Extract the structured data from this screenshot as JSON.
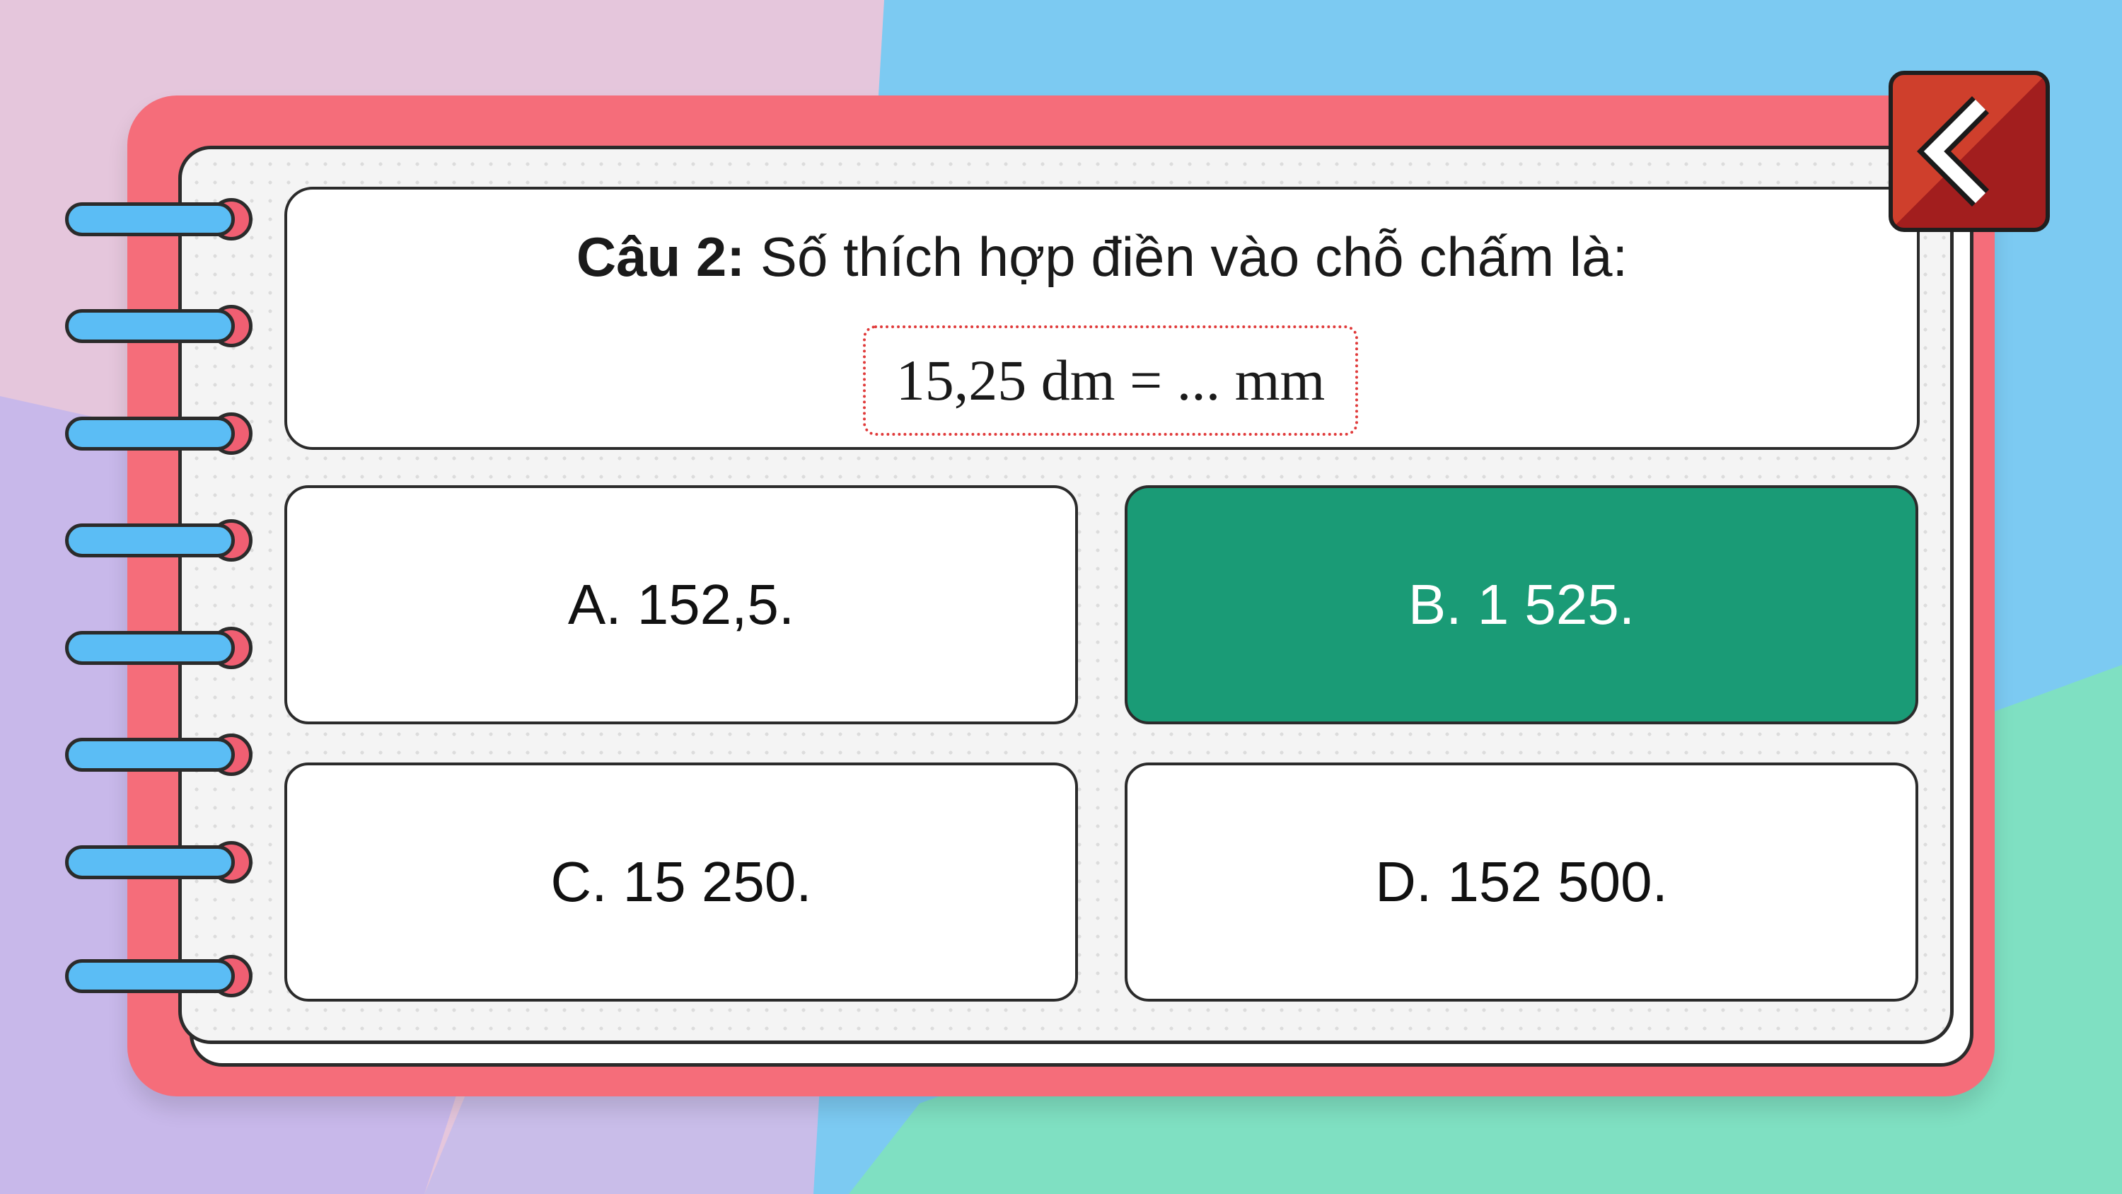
{
  "colors": {
    "cover": "#f56d7a",
    "correct_answer": "#1a9b76",
    "ring": "#5bbdf5",
    "back_button": "#cf3f2c"
  },
  "question": {
    "label": "Câu 2:",
    "text": " Số thích hợp điền vào chỗ chấm là:",
    "formula": "15,25 dm = ... mm"
  },
  "answers": [
    {
      "text": "A. 152,5.",
      "correct": false
    },
    {
      "text": "B. 1 525.",
      "correct": true
    },
    {
      "text": "C. 15 250.",
      "correct": false
    },
    {
      "text": "D. 152 500.",
      "correct": false
    }
  ],
  "back_button": {
    "icon": "chevron-left-icon"
  }
}
